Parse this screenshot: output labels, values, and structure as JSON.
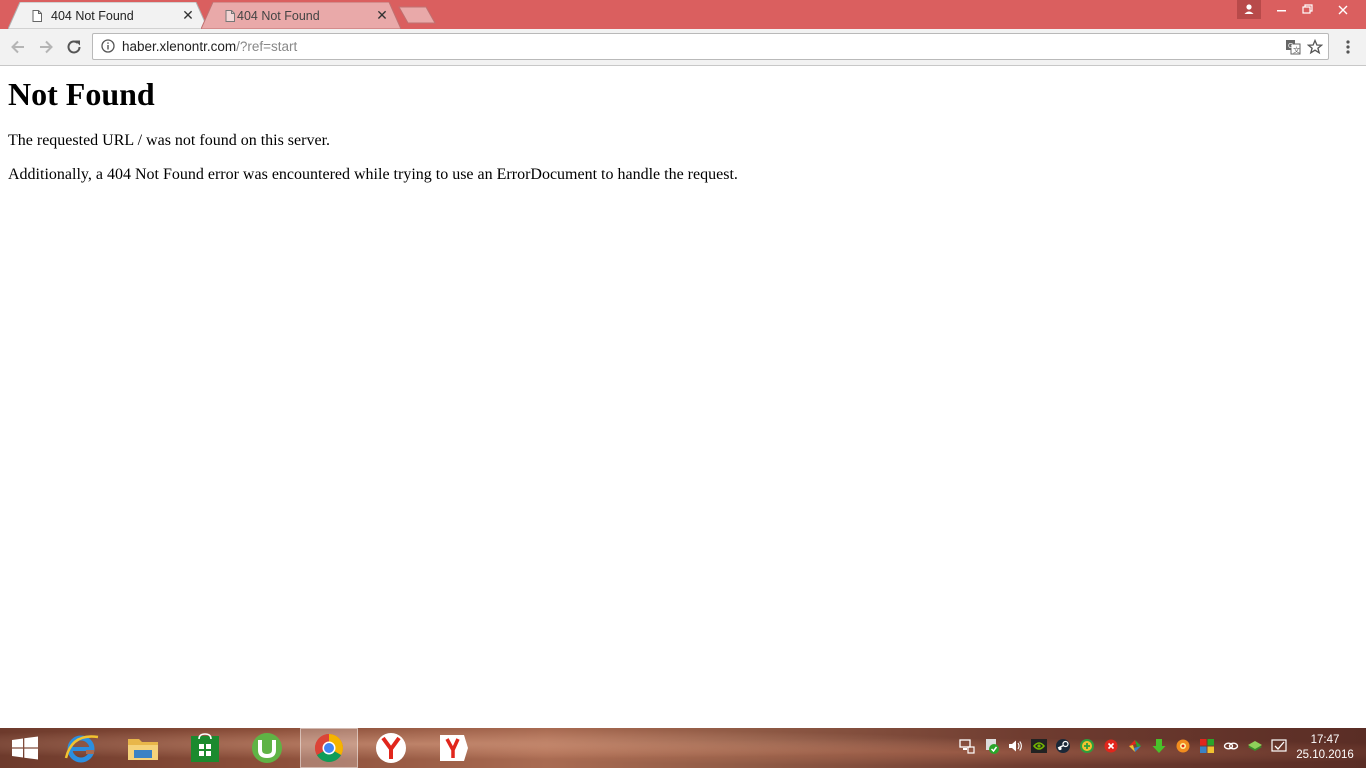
{
  "browser": {
    "tabs": [
      {
        "title": "404 Not Found",
        "active": true
      },
      {
        "title": "404 Not Found",
        "active": false
      }
    ],
    "window_controls": [
      "minimize",
      "restore",
      "close"
    ],
    "address": {
      "host": "haber.xlenontr.com",
      "path": "/?ref=start"
    }
  },
  "page": {
    "heading": "Not Found",
    "paragraph1": "The requested URL / was not found on this server.",
    "paragraph2": "Additionally, a 404 Not Found error was encountered while trying to use an ErrorDocument to handle the request."
  },
  "taskbar": {
    "apps": [
      "windows-start",
      "internet-explorer",
      "file-explorer",
      "windows-store",
      "utorrent",
      "chrome",
      "yandex-browser",
      "yandex"
    ],
    "active_app": "chrome",
    "clock": {
      "time": "17:47",
      "date": "25.10.2016"
    }
  },
  "colors": {
    "titlebar": "#da5f5f",
    "toolbar": "#f2f2f2"
  }
}
